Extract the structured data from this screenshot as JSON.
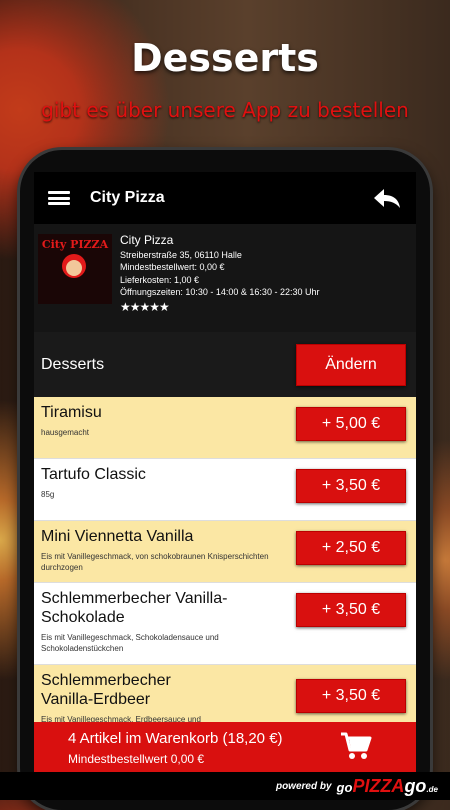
{
  "promo": {
    "title": "Desserts",
    "subtitle": "gibt es über unsere App zu bestellen"
  },
  "appbar": {
    "title": "City Pizza",
    "menu_icon": "hamburger-menu-icon",
    "back_icon": "back-arrow-icon"
  },
  "shop": {
    "logo_text": "City PIZZA",
    "name": "City Pizza",
    "address": "Streiberstraße 35, 06110 Halle",
    "min_order": "Mindestbestellwert: 0,00 €",
    "delivery_cost": "Lieferkosten: 1,00 €",
    "opening_hours": "Öffnungszeiten: 10:30 - 14:00 & 16:30 - 22:30 Uhr",
    "rating_stars": 5,
    "stars_text": "★★★★★"
  },
  "category": {
    "title": "Desserts",
    "change_label": "Ändern"
  },
  "items": [
    {
      "name": "Tiramisu",
      "desc": "hausgemacht",
      "price": "+ 5,00 €"
    },
    {
      "name": "Tartufo Classic",
      "desc": "85g",
      "price": "+ 3,50 €"
    },
    {
      "name": "Mini Viennetta Vanilla",
      "desc": "Eis mit Vanillegeschmack, von schokobraunen Knisperschichten durchzogen",
      "price": "+ 2,50 €"
    },
    {
      "name": "Schlemmerbecher Vanilla-Schokolade",
      "desc": "Eis mit Vanillegeschmack, Schokoladensauce und Schokoladenstückchen",
      "price": "+ 3,50 €"
    },
    {
      "name": "Schlemmerbecher Vanilla-Erdbeer",
      "desc": "Eis mit Vanillegeschmack, Erdbeersauce und",
      "price": "+ 3,50 €"
    }
  ],
  "cart": {
    "summary": "4 Artikel im Warenkorb (18,20 €)",
    "min_order": "Mindestbestellwert 0,00 €",
    "icon": "shopping-cart-icon"
  },
  "footer": {
    "powered": "powered by",
    "brand_go": "go",
    "brand_pizza": "PIZZA",
    "brand_go2": "go",
    "brand_tld": ".de"
  },
  "colors": {
    "accent_red": "#d9100f",
    "item_yellow": "#fbe7a4",
    "promo_red": "#e01010"
  }
}
